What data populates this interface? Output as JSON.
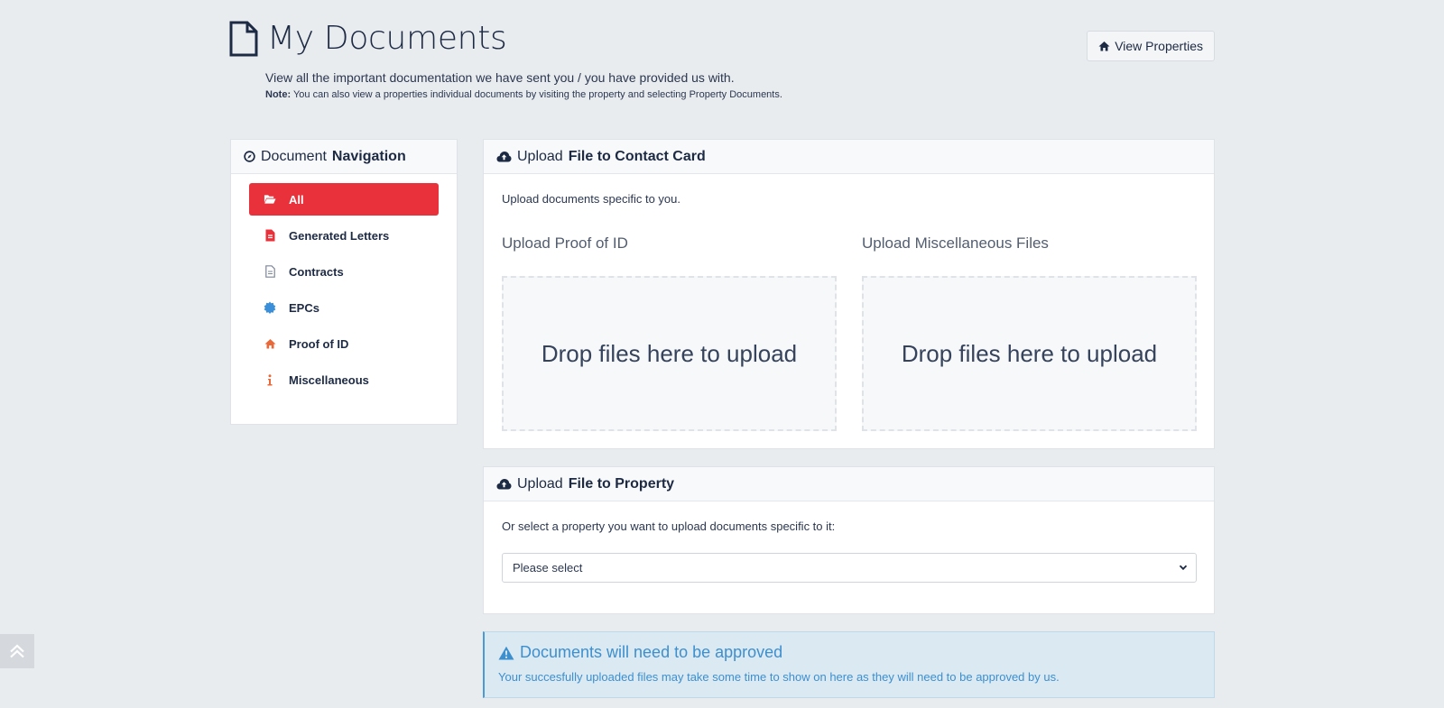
{
  "header": {
    "title": "My Documents",
    "subtitle": "View all the important documentation we have sent you / you have provided us with.",
    "note_label": "Note:",
    "note_text": "You can also view a properties individual documents by visiting the property and selecting Property Documents.",
    "view_properties_label": "View Properties"
  },
  "nav": {
    "title_light": "Document",
    "title_bold": "Navigation",
    "items": [
      {
        "label": "All",
        "icon": "folder-open-icon",
        "active": true
      },
      {
        "label": "Generated Letters",
        "icon": "file-pdf-icon"
      },
      {
        "label": "Contracts",
        "icon": "file-text-icon"
      },
      {
        "label": "EPCs",
        "icon": "certificate-icon"
      },
      {
        "label": "Proof of ID",
        "icon": "home-icon"
      },
      {
        "label": "Miscellaneous",
        "icon": "info-icon"
      }
    ]
  },
  "upload_contact": {
    "title_light": "Upload",
    "title_bold": "File to Contact Card",
    "description": "Upload documents specific to you.",
    "proof_label": "Upload Proof of ID",
    "misc_label": "Upload Miscellaneous Files",
    "dropzone_text": "Drop files here to upload"
  },
  "upload_property": {
    "title_light": "Upload",
    "title_bold": "File to Property",
    "description": "Or select a property you want to upload documents specific to it:",
    "select_value": "Please select"
  },
  "alert": {
    "title": "Documents will need to be approved",
    "text": "Your succesfully uploaded files may take some time to show on here as they will need to be approved by us."
  },
  "colors": {
    "accent": "#e8313a",
    "navy": "#1d2a44",
    "info": "#3d8fce"
  }
}
